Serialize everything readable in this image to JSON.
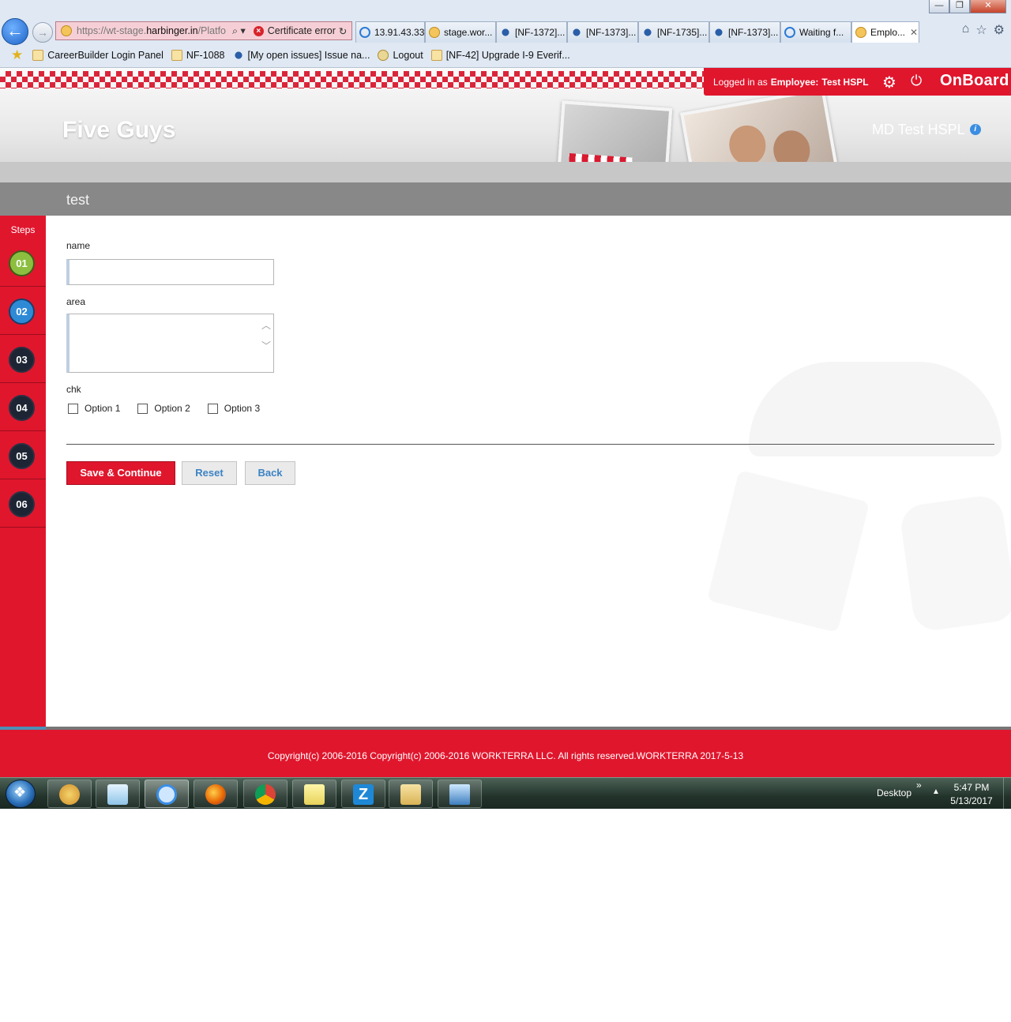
{
  "browser": {
    "window_buttons": [
      "—",
      "❐",
      "✕"
    ],
    "address": {
      "url_prefix": "https://wt-stage.",
      "url_domain": "harbinger.in",
      "url_suffix": "/Platfo",
      "search_glyph": "⌕ ▾",
      "cert_error": "Certificate error",
      "refresh_glyph": "↻"
    },
    "tabs": [
      {
        "label": "13.91.43.33",
        "icon": "ie-icon"
      },
      {
        "label": "stage.wor...",
        "icon": "site-icon"
      },
      {
        "label": "[NF-1372]...",
        "icon": "jira-icon"
      },
      {
        "label": "[NF-1373]...",
        "icon": "jira-icon"
      },
      {
        "label": "[NF-1735]...",
        "icon": "jira-icon"
      },
      {
        "label": "[NF-1373]...",
        "icon": "jira-icon"
      },
      {
        "label": "Waiting f...",
        "icon": "ie-icon"
      },
      {
        "label": "Emplo...",
        "icon": "site-icon",
        "active": true
      }
    ],
    "tab_close": "✕",
    "nav_icons": {
      "home": "⌂",
      "favorites": "☆",
      "tools": "⚙"
    },
    "favorites": [
      {
        "label": "CareerBuilder Login Panel",
        "icon": "page-icon"
      },
      {
        "label": "NF-1088",
        "icon": "page-icon"
      },
      {
        "label": "[My open issues] Issue na...",
        "icon": "jira-icon"
      },
      {
        "label": "Logout",
        "icon": "globe-icon"
      },
      {
        "label": "[NF-42] Upgrade I-9 Everif...",
        "icon": "page-icon"
      }
    ]
  },
  "header": {
    "brand": "Five Guys",
    "login_prefix": "Logged in as",
    "login_role": "Employee:",
    "login_user": "Test HSPL",
    "app_name": "OnBoard",
    "user_display": "MD Test HSPL",
    "info_glyph": "i",
    "gear_glyph": "⚙",
    "power_glyph": "⏻"
  },
  "page": {
    "title": "test"
  },
  "steps": {
    "label": "Steps",
    "items": [
      {
        "number": "01",
        "state": "done"
      },
      {
        "number": "02",
        "state": "current"
      },
      {
        "number": "03",
        "state": "pending"
      },
      {
        "number": "04",
        "state": "pending"
      },
      {
        "number": "05",
        "state": "pending"
      },
      {
        "number": "06",
        "state": "pending"
      }
    ]
  },
  "form": {
    "name_label": "name",
    "name_value": "",
    "area_label": "area",
    "area_value": "",
    "chk_label": "chk",
    "options": [
      "Option 1",
      "Option 2",
      "Option 3"
    ],
    "options_checked": [
      false,
      false,
      false
    ],
    "buttons": {
      "save": "Save & Continue",
      "reset": "Reset",
      "back": "Back"
    }
  },
  "footer": {
    "copyright": "Copyright(c) 2006-2016 Copyright(c) 2006-2016 WORKTERRA LLC. All rights reserved.WORKTERRA 2017-5-13"
  },
  "taskbar": {
    "desktop_label": "Desktop",
    "chevron": "»",
    "time": "5:47 PM",
    "date": "5/13/2017",
    "apps": [
      "paint-icon",
      "notepad-icon",
      "ie-icon",
      "firefox-icon",
      "chrome-icon",
      "sticky-notes-icon",
      "z-app-icon",
      "file-explorer-icon",
      "screenshot-icon"
    ]
  },
  "colors": {
    "brand_red": "#e0162d",
    "step_done": "#8cbf3f",
    "step_current": "#2f8ad6",
    "step_pending": "#1d2433",
    "link_blue": "#3c83c4"
  }
}
